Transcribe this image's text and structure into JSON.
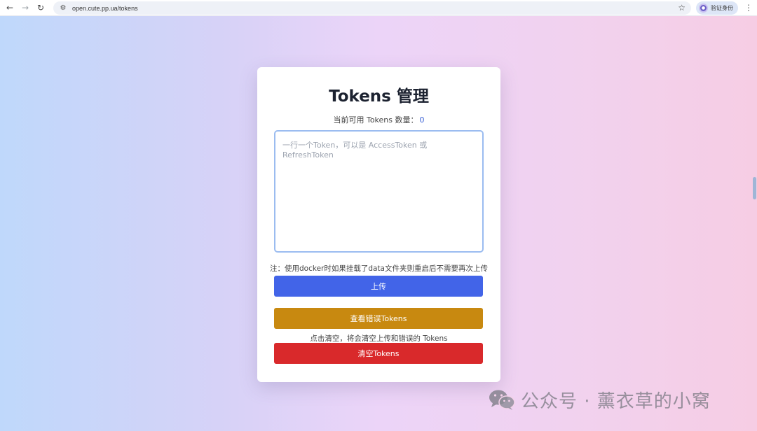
{
  "browser": {
    "url": "open.cute.pp.ua/tokens",
    "profile_label": "验证身份"
  },
  "card": {
    "title": "Tokens 管理",
    "count_label": "当前可用 Tokens 数量：",
    "count_value": "0",
    "input": {
      "value": "",
      "placeholder": "一行一个Token，可以是 AccessToken 或 RefreshToken"
    },
    "note": "注：使用docker时如果挂载了data文件夹则重启后不需要再次上传",
    "upload_label": "上传",
    "view_errors_label": "查看错误Tokens",
    "clear_hint": "点击清空，将会清空上传和错误的 Tokens",
    "clear_label": "清空Tokens"
  },
  "watermark": {
    "text": "公众号 · 薰衣草的小窝",
    "icon": "wechat-icon"
  },
  "colors": {
    "upload": "#4264e8",
    "view_errors": "#c88910",
    "clear": "#d9292b",
    "count_value": "#3b62d6"
  }
}
